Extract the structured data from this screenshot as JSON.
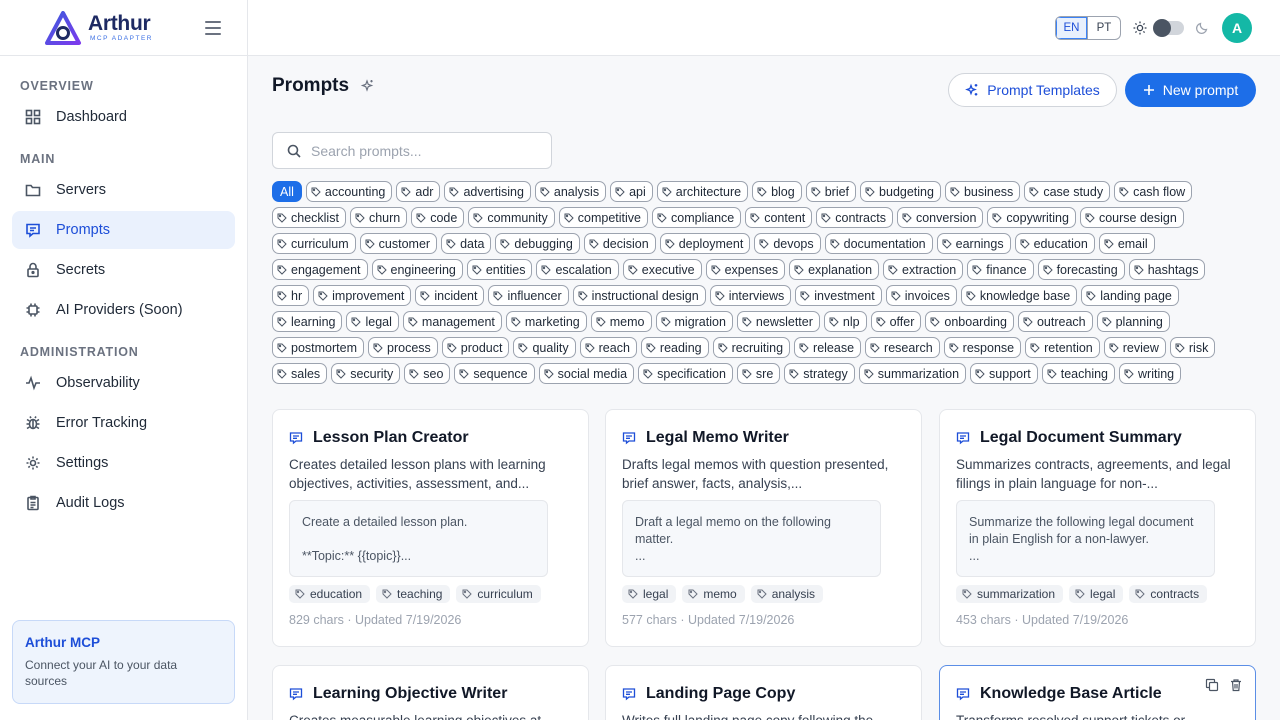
{
  "brand": {
    "name": "Arthur",
    "sub": "MCP ADAPTER"
  },
  "nav": {
    "overview": "OVERVIEW",
    "main": "MAIN",
    "administration": "ADMINISTRATION",
    "items": [
      {
        "label": "Dashboard",
        "icon": "dashboard-icon"
      },
      {
        "label": "Servers",
        "icon": "folder-icon"
      },
      {
        "label": "Prompts",
        "icon": "message-icon"
      },
      {
        "label": "Secrets",
        "icon": "lock-icon"
      },
      {
        "label": "AI Providers (Soon)",
        "icon": "chip-icon"
      },
      {
        "label": "Observability",
        "icon": "activity-icon"
      },
      {
        "label": "Error Tracking",
        "icon": "bug-icon"
      },
      {
        "label": "Settings",
        "icon": "gear-icon"
      },
      {
        "label": "Audit Logs",
        "icon": "clipboard-icon"
      }
    ]
  },
  "promo": {
    "title": "Arthur MCP",
    "text": "Connect your AI to your data sources"
  },
  "topbar": {
    "lang_en": "EN",
    "lang_pt": "PT",
    "avatar": "A"
  },
  "page": {
    "title": "Prompts",
    "templates_button": "Prompt Templates",
    "new_button": "New prompt",
    "search_placeholder": "Search prompts..."
  },
  "tag_filters": [
    "All",
    "accounting",
    "adr",
    "advertising",
    "analysis",
    "api",
    "architecture",
    "blog",
    "brief",
    "budgeting",
    "business",
    "case study",
    "cash flow",
    "checklist",
    "churn",
    "code",
    "community",
    "competitive",
    "compliance",
    "content",
    "contracts",
    "conversion",
    "copywriting",
    "course design",
    "curriculum",
    "customer",
    "data",
    "debugging",
    "decision",
    "deployment",
    "devops",
    "documentation",
    "earnings",
    "education",
    "email",
    "engagement",
    "engineering",
    "entities",
    "escalation",
    "executive",
    "expenses",
    "explanation",
    "extraction",
    "finance",
    "forecasting",
    "hashtags",
    "hr",
    "improvement",
    "incident",
    "influencer",
    "instructional design",
    "interviews",
    "investment",
    "invoices",
    "knowledge base",
    "landing page",
    "learning",
    "legal",
    "management",
    "marketing",
    "memo",
    "migration",
    "newsletter",
    "nlp",
    "offer",
    "onboarding",
    "outreach",
    "planning",
    "postmortem",
    "process",
    "product",
    "quality",
    "reach",
    "reading",
    "recruiting",
    "release",
    "research",
    "response",
    "retention",
    "review",
    "risk",
    "sales",
    "security",
    "seo",
    "sequence",
    "social media",
    "specification",
    "sre",
    "strategy",
    "summarization",
    "support",
    "teaching",
    "writing"
  ],
  "cards": [
    {
      "title": "Lesson Plan Creator",
      "desc": "Creates detailed lesson plans with learning objectives, activities, assessment, and...",
      "preview": "Create a detailed lesson plan.\n\n**Topic:** {{topic}}...",
      "tags": [
        "education",
        "teaching",
        "curriculum"
      ],
      "meta": "829 chars · Updated 7/19/2026"
    },
    {
      "title": "Legal Memo Writer",
      "desc": "Drafts legal memos with question presented, brief answer, facts, analysis,...",
      "preview": "Draft a legal memo on the following matter.\n...",
      "tags": [
        "legal",
        "memo",
        "analysis"
      ],
      "meta": "577 chars · Updated 7/19/2026"
    },
    {
      "title": "Legal Document Summary",
      "desc": "Summarizes contracts, agreements, and legal filings in plain language for non-...",
      "preview": "Summarize the following legal document in plain English for a non-lawyer.\n...",
      "tags": [
        "summarization",
        "legal",
        "contracts"
      ],
      "meta": "453 chars · Updated 7/19/2026"
    },
    {
      "title": "Learning Objective Writer",
      "desc": "Creates measurable learning objectives at..."
    },
    {
      "title": "Landing Page Copy",
      "desc": "Writes full landing page copy following the..."
    },
    {
      "title": "Knowledge Base Article",
      "desc": "Transforms resolved support tickets or..."
    }
  ]
}
